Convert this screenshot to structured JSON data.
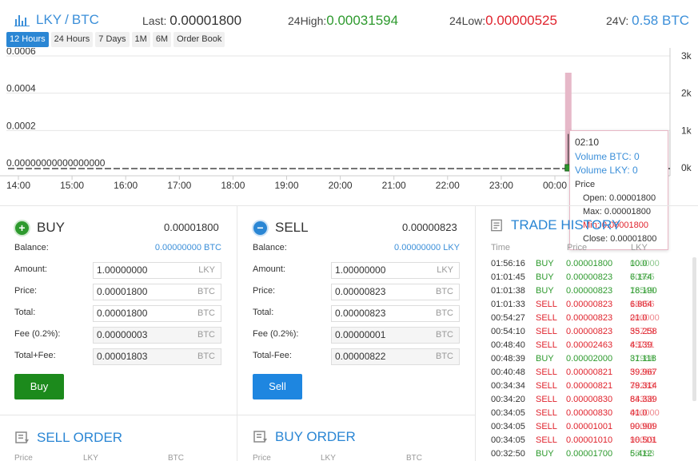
{
  "header": {
    "base": "LKY",
    "sep": "/",
    "quote": "BTC",
    "last_label": "Last:",
    "last_value": "0.00001800",
    "high_label": "24High:",
    "high_value": "0.00031594",
    "low_label": "24Low:",
    "low_value": "0.00000525",
    "vol_label": "24V:",
    "vol_value": "0.58 BTC"
  },
  "tabs": [
    {
      "label": "12 Hours",
      "active": true
    },
    {
      "label": "24 Hours"
    },
    {
      "label": "7 Days"
    },
    {
      "label": "1M"
    },
    {
      "label": "6M"
    },
    {
      "label": "Order Book"
    }
  ],
  "chart_data": {
    "type": "candlestick",
    "x_ticks": [
      "14:00",
      "15:00",
      "16:00",
      "17:00",
      "18:00",
      "19:00",
      "20:00",
      "21:00",
      "22:00",
      "23:00",
      "00:00",
      "01:00"
    ],
    "y_left_ticks": [
      "0.0006",
      "0.0004",
      "0.0002",
      "0.00000000000000000"
    ],
    "y_left_ticks_values": [
      0.0006,
      0.0004,
      0.0002,
      0
    ],
    "y_right_ticks": [
      "3k",
      "2k",
      "1k",
      "0k"
    ],
    "y_right_ticks_values": [
      3000,
      2000,
      1000,
      0
    ],
    "ylim": [
      0,
      0.0006
    ],
    "ylim_volume": [
      0,
      3000
    ],
    "candles": [
      {
        "time": "00:15",
        "open": 1.8e-05,
        "high": 0.00031,
        "low": 5e-06,
        "close": 1.8e-05,
        "color": "#2e9a2e"
      }
    ],
    "volume_bars": [
      {
        "time": "00:15",
        "value": 2550,
        "color": "#e6b8c8"
      }
    ],
    "baseline_dashed": true,
    "colors": {
      "up": "#2e9a2e",
      "volume": "#e6b8c8",
      "grid": "#e6e6e6"
    }
  },
  "tooltip": {
    "time": "02:10",
    "vol_btc": "Volume BTC: 0",
    "vol_lky": "Volume LKY: 0",
    "price_label": "Price",
    "open": "Open: 0.00001800",
    "max": "Max: 0.00001800",
    "min": "Min: 0.00001800",
    "close": "Close: 0.00001800"
  },
  "buy": {
    "title": "BUY",
    "title_value": "0.00001800",
    "balance_label": "Balance:",
    "balance_value": "0.00000000 BTC",
    "rows": [
      {
        "label": "Amount:",
        "value": "1.00000000",
        "unit": "LKY",
        "ro": false
      },
      {
        "label": "Price:",
        "value": "0.00001800",
        "unit": "BTC",
        "ro": false
      },
      {
        "label": "Total:",
        "value": "0.00001800",
        "unit": "BTC",
        "ro": false
      },
      {
        "label": "Fee (0.2%):",
        "value": "0.00000003",
        "unit": "BTC",
        "ro": true
      },
      {
        "label": "Total+Fee:",
        "value": "0.00001803",
        "unit": "BTC",
        "ro": true
      }
    ],
    "button": "Buy"
  },
  "sell": {
    "title": "SELL",
    "title_value": "0.00000823",
    "balance_label": "Balance:",
    "balance_value": "0.00000000 LKY",
    "rows": [
      {
        "label": "Amount:",
        "value": "1.00000000",
        "unit": "LKY",
        "ro": false
      },
      {
        "label": "Price:",
        "value": "0.00000823",
        "unit": "BTC",
        "ro": false
      },
      {
        "label": "Total:",
        "value": "0.00000823",
        "unit": "BTC",
        "ro": false
      },
      {
        "label": "Fee (0.2%):",
        "value": "0.00000001",
        "unit": "BTC",
        "ro": true
      },
      {
        "label": "Total-Fee:",
        "value": "0.00000822",
        "unit": "BTC",
        "ro": true
      }
    ],
    "button": "Sell"
  },
  "trade_history": {
    "title": "TRADE HISTORY",
    "headers": [
      "Time",
      "Price",
      "LKY"
    ],
    "rows": [
      {
        "time": "01:56:16",
        "type": "BUY",
        "price": "0.00001800",
        "amt": "10.0",
        "amt_dim": "000000"
      },
      {
        "time": "01:01:45",
        "type": "BUY",
        "price": "0.00000823",
        "amt": "6.174",
        "amt_dim": "70995"
      },
      {
        "time": "01:01:38",
        "type": "BUY",
        "price": "0.00000823",
        "amt": "18.190",
        "amt_dim": "76549"
      },
      {
        "time": "01:01:33",
        "type": "SELL",
        "price": "0.00000823",
        "amt": "6.864",
        "amt_dim": "18456"
      },
      {
        "time": "00:54:27",
        "type": "SELL",
        "price": "0.00000823",
        "amt": "21.0",
        "amt_dim": "000000"
      },
      {
        "time": "00:54:10",
        "type": "SELL",
        "price": "0.00000823",
        "amt": "35.258",
        "amt_dim": "53719"
      },
      {
        "time": "00:48:40",
        "type": "SELL",
        "price": "0.00002463",
        "amt": "4.139",
        "amt_dim": "65731"
      },
      {
        "time": "00:48:39",
        "type": "BUY",
        "price": "0.00002000",
        "amt": "31.118",
        "amt_dim": "87988"
      },
      {
        "time": "00:40:48",
        "type": "SELL",
        "price": "0.00000821",
        "amt": "39.967",
        "amt_dim": "59266"
      },
      {
        "time": "00:34:34",
        "type": "SELL",
        "price": "0.00000821",
        "amt": "79.314",
        "amt_dim": "38283"
      },
      {
        "time": "00:34:20",
        "type": "SELL",
        "price": "0.00000830",
        "amt": "84.339",
        "amt_dim": "63398"
      },
      {
        "time": "00:34:05",
        "type": "SELL",
        "price": "0.00000830",
        "amt": "41.0",
        "amt_dim": "000000"
      },
      {
        "time": "00:34:05",
        "type": "SELL",
        "price": "0.00001001",
        "amt": "90.909",
        "amt_dim": "09090"
      },
      {
        "time": "00:34:05",
        "type": "SELL",
        "price": "0.00001010",
        "amt": "10.501",
        "amt_dim": "98019"
      },
      {
        "time": "00:32:50",
        "type": "BUY",
        "price": "0.00001700",
        "amt": "5.412",
        "amt_dim": "66093"
      }
    ]
  },
  "sell_order": {
    "title": "SELL ORDER",
    "headers": [
      "Price",
      "LKY",
      "BTC"
    ]
  },
  "buy_order": {
    "title": "BUY ORDER",
    "headers": [
      "Price",
      "LKY",
      "BTC"
    ]
  }
}
